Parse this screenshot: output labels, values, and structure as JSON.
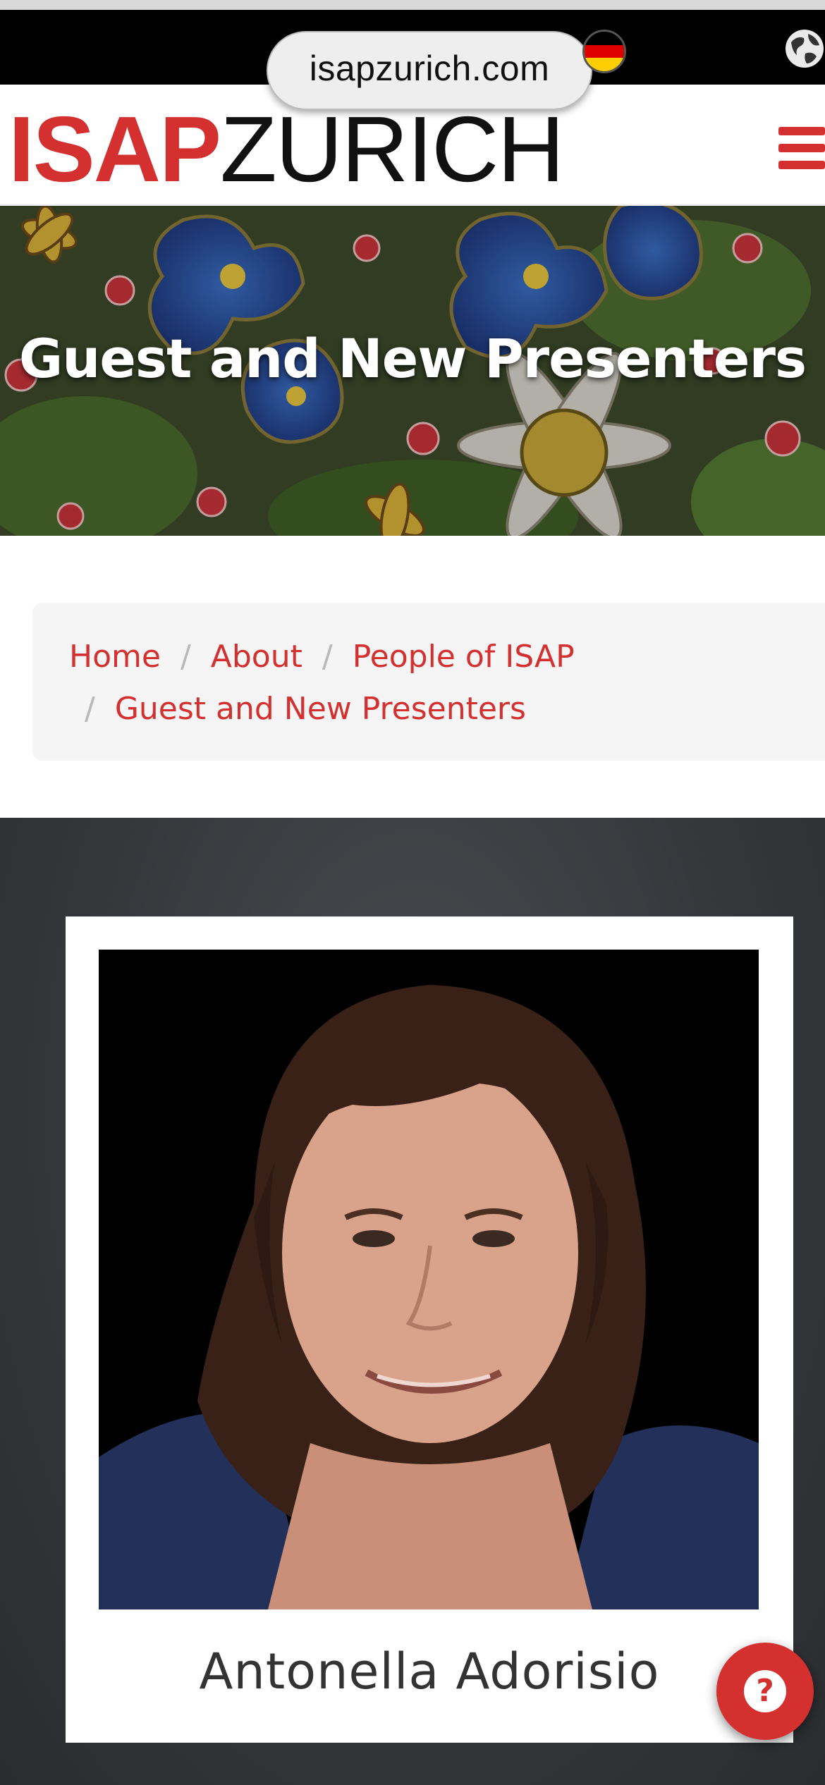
{
  "browser": {
    "url": "isapzurich.com",
    "language_flag_icon": "germany-flag-icon",
    "globe_icon": "globe-icon"
  },
  "header": {
    "logo_part1": "ISAP",
    "logo_part2": "ZURICH",
    "menu_icon": "hamburger-menu-icon",
    "accent_color": "#d3302f"
  },
  "hero": {
    "title": "Guest and New Presenters"
  },
  "breadcrumb": {
    "items": [
      "Home",
      "About",
      "People of ISAP",
      "Guest and New Presenters"
    ],
    "separator": "/"
  },
  "presenter": {
    "name": "Antonella Adorisio"
  },
  "help_button": {
    "icon": "question-icon",
    "glyph": "?"
  }
}
